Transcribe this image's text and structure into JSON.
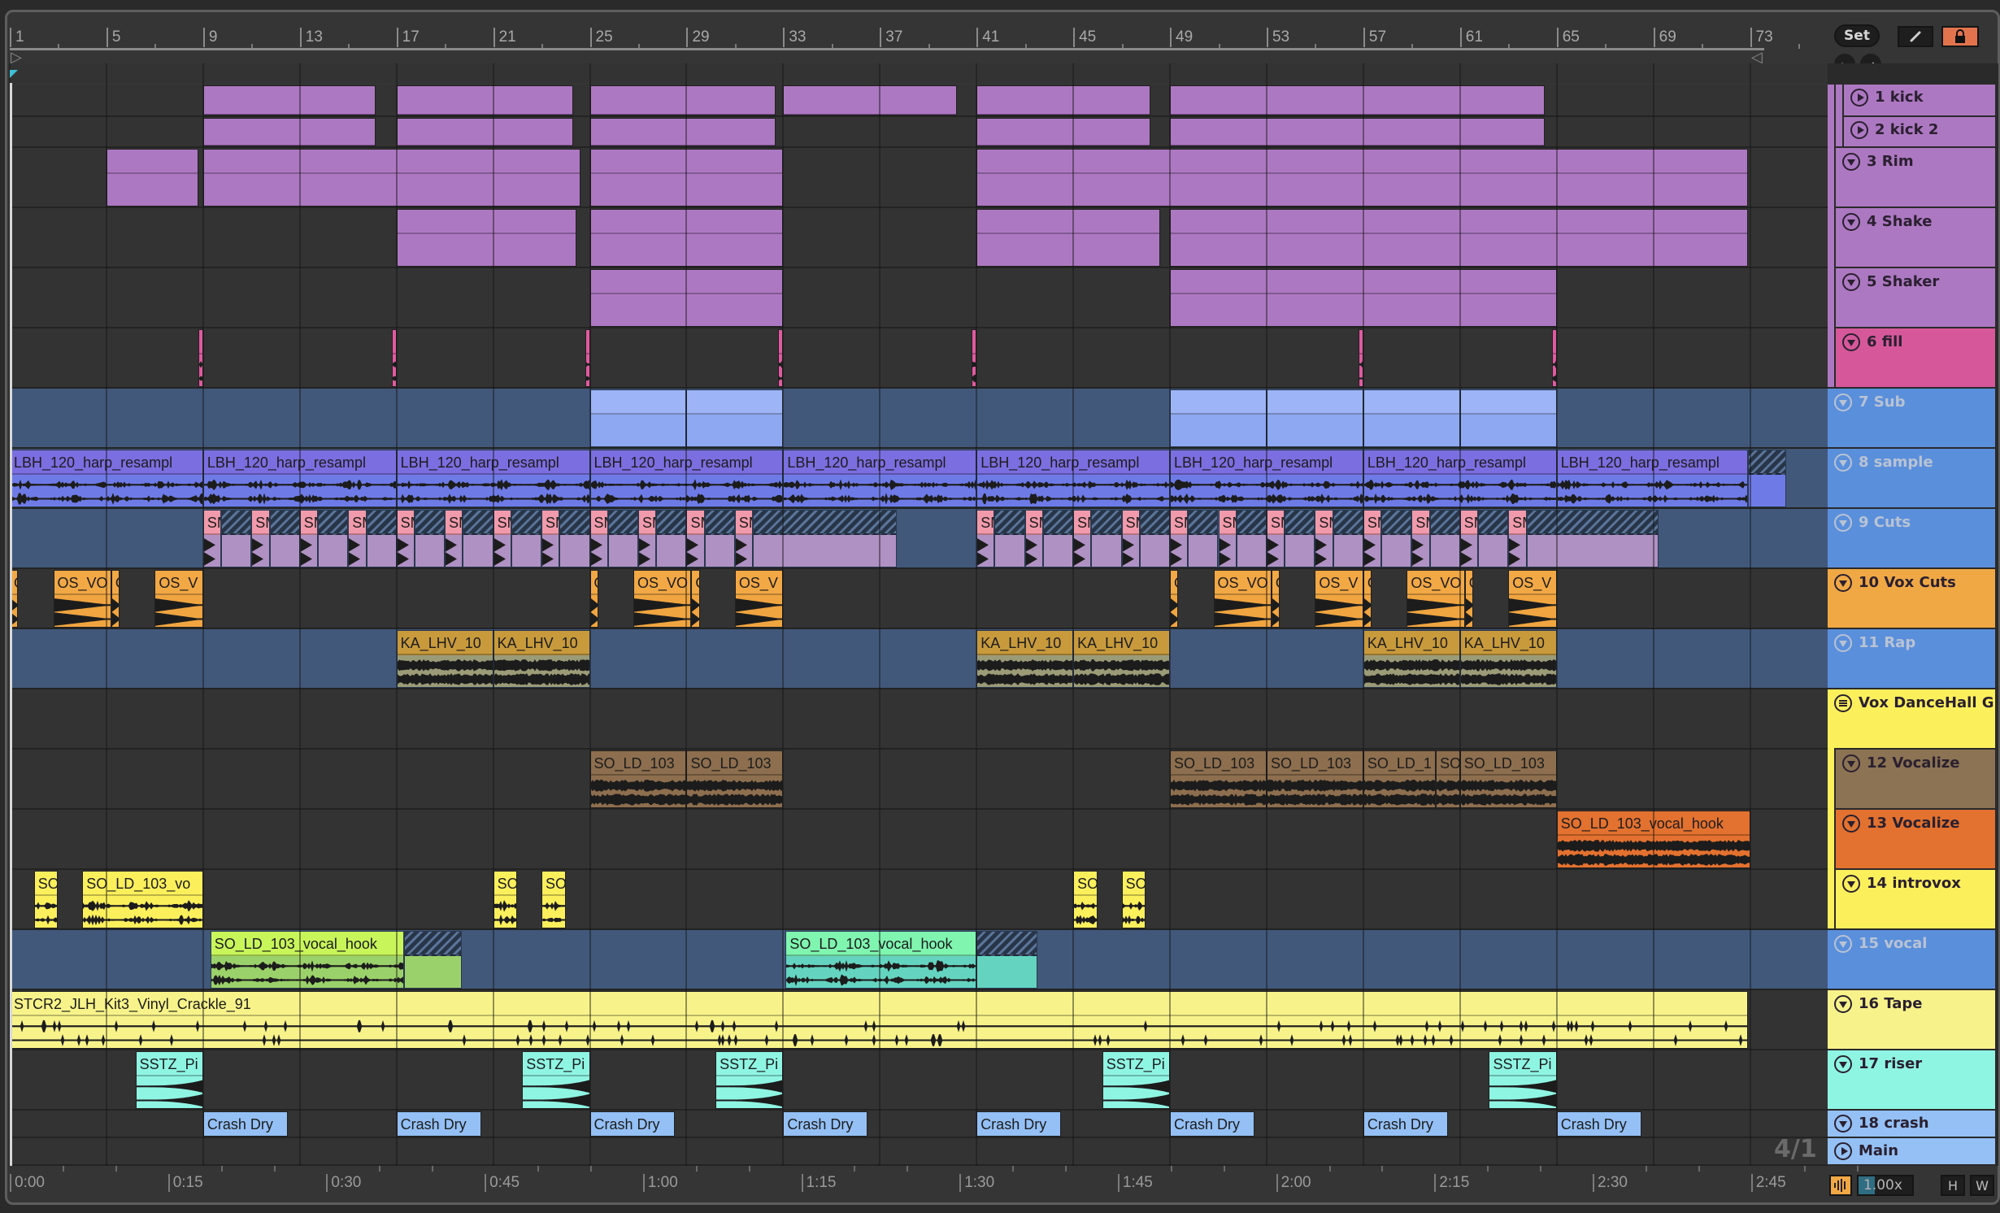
{
  "header_controls": {
    "set_label": "Set",
    "draw_mode_icon": "pencil-icon",
    "lock_icon": "lock-icon",
    "back_icon": "arrow-left-icon",
    "forward_icon": "arrow-right-icon"
  },
  "ruler": {
    "bar_labels": [
      "1",
      "5",
      "9",
      "13",
      "17",
      "21",
      "25",
      "29",
      "33",
      "37",
      "41",
      "45",
      "49",
      "53",
      "57",
      "61",
      "65",
      "69",
      "73"
    ],
    "loop_start_bar": 1,
    "loop_end_bar": 73
  },
  "time_ruler": {
    "labels": [
      "0:00",
      "0:15",
      "0:30",
      "0:45",
      "1:00",
      "1:15",
      "1:30",
      "1:45",
      "2:00",
      "2:15",
      "2:30",
      "2:45"
    ]
  },
  "grid_signature": "4/1",
  "footer": {
    "zoom_value": "1.00x",
    "h_label": "H",
    "w_label": "W",
    "waveform_icon": "waveform-icon"
  },
  "colors": {
    "accent_orange": "#e2734d",
    "lane_dark": "#333333",
    "lane_blue": "#41587a"
  },
  "tracks": [
    {
      "name": "1 kick",
      "color": "#ad78c2",
      "fold": "play",
      "lane": "dark",
      "kind": "blank",
      "clip": "#ad78c2",
      "body": "#ad78c2",
      "clips": [
        {
          "s": 9,
          "e": 16.15
        },
        {
          "s": 17,
          "e": 24.3
        },
        {
          "s": 25,
          "e": 32.7
        },
        {
          "s": 33,
          "e": 40.2
        },
        {
          "s": 41,
          "e": 48.2
        },
        {
          "s": 49,
          "e": 64.5
        }
      ]
    },
    {
      "name": "2 kick 2",
      "color": "#ad78c2",
      "fold": "play",
      "lane": "dark",
      "kind": "blank",
      "clip": "#ad78c2",
      "body": "#ad78c2",
      "clips": [
        {
          "s": 9,
          "e": 16.15
        },
        {
          "s": 17,
          "e": 24.3
        },
        {
          "s": 25,
          "e": 32.7
        },
        {
          "s": 41,
          "e": 48.2
        },
        {
          "s": 49,
          "e": 64.5
        }
      ]
    },
    {
      "name": "3 Rim",
      "color": "#ad78c2",
      "fold": "down",
      "lane": "dark",
      "kind": "midi",
      "clip": "#ad78c2",
      "body": "#ad78c2",
      "clips": [
        {
          "s": 5,
          "e": 8.8
        },
        {
          "s": 9,
          "e": 24.6
        },
        {
          "s": 25,
          "e": 33
        },
        {
          "s": 41,
          "e": 72.9
        }
      ]
    },
    {
      "name": "4 Shake",
      "color": "#ad78c2",
      "fold": "down",
      "lane": "dark",
      "kind": "midi",
      "clip": "#ad78c2",
      "body": "#ad78c2",
      "clips": [
        {
          "s": 17,
          "e": 24.45
        },
        {
          "s": 25,
          "e": 33
        },
        {
          "s": 41,
          "e": 48.6
        },
        {
          "s": 49,
          "e": 72.9
        }
      ]
    },
    {
      "name": "5 Shaker",
      "color": "#ad78c2",
      "fold": "down",
      "lane": "dark",
      "kind": "midi-dense",
      "clip": "#ad78c2",
      "body": "#ad78c2",
      "clips": [
        {
          "s": 25,
          "e": 33
        },
        {
          "s": 49,
          "e": 65
        }
      ]
    },
    {
      "name": "6 fill",
      "color": "#d6589a",
      "fold": "down",
      "lane": "dark",
      "kind": "audio",
      "clip": "#e05aa0",
      "body": "#e05aa0",
      "clips": [
        {
          "s": 8.8,
          "e": 9
        },
        {
          "s": 16.8,
          "e": 17
        },
        {
          "s": 24.8,
          "e": 25
        },
        {
          "s": 32.8,
          "e": 33
        },
        {
          "s": 40.8,
          "e": 41
        },
        {
          "s": 56.8,
          "e": 57
        },
        {
          "s": 64.8,
          "e": 65
        }
      ]
    },
    {
      "name": "7 Sub",
      "color": "#5a8fdc",
      "fold": "down",
      "muted": true,
      "lane": "blue",
      "kind": "notes",
      "clip": "#9db4f6",
      "body": "#8ea8f2",
      "clips": [
        {
          "s": 25,
          "e": 29
        },
        {
          "s": 29,
          "e": 33
        },
        {
          "s": 49,
          "e": 53
        },
        {
          "s": 53,
          "e": 57
        },
        {
          "s": 57,
          "e": 61
        },
        {
          "s": 61,
          "e": 65
        }
      ]
    },
    {
      "name": "8 sample",
      "color": "#5a8fdc",
      "fold": "down",
      "muted": true,
      "lane": "blue",
      "kind": "audio",
      "clip": "#7b6ee0",
      "body": "#6e7be6",
      "clips": [
        {
          "s": 1,
          "e": 9,
          "n": "LBH_120_harp_resampl"
        },
        {
          "s": 9,
          "e": 17,
          "n": "LBH_120_harp_resampl"
        },
        {
          "s": 17,
          "e": 25,
          "n": "LBH_120_harp_resampl"
        },
        {
          "s": 25,
          "e": 33,
          "n": "LBH_120_harp_resampl"
        },
        {
          "s": 33,
          "e": 41,
          "n": "LBH_120_harp_resampl"
        },
        {
          "s": 41,
          "e": 49,
          "n": "LBH_120_harp_resampl"
        },
        {
          "s": 49,
          "e": 57,
          "n": "LBH_120_harp_resampl"
        },
        {
          "s": 57,
          "e": 65,
          "n": "LBH_120_harp_resampl"
        },
        {
          "s": 65,
          "e": 72.9,
          "n": "LBH_120_harp_resampl"
        },
        {
          "s": 72.9,
          "e": 74.5,
          "k": "hatch"
        }
      ]
    },
    {
      "name": "9 Cuts",
      "color": "#5a8fdc",
      "fold": "down",
      "muted": true,
      "lane": "blue",
      "kind": "audio-short",
      "clip": "#f19aab",
      "body": "#b091c3",
      "clips": [
        {
          "s": 9,
          "e": 9.75,
          "n": "SM"
        },
        {
          "s": 9.75,
          "e": 11,
          "k": "hatch"
        },
        {
          "s": 11,
          "e": 11.75,
          "n": "SM"
        },
        {
          "s": 11.75,
          "e": 13,
          "k": "hatch"
        },
        {
          "s": 13,
          "e": 13.75,
          "n": "SM"
        },
        {
          "s": 13.75,
          "e": 15,
          "k": "hatch"
        },
        {
          "s": 15,
          "e": 15.75,
          "n": "SM"
        },
        {
          "s": 15.75,
          "e": 17,
          "k": "hatch"
        },
        {
          "s": 17,
          "e": 17.75,
          "n": "SM"
        },
        {
          "s": 17.75,
          "e": 19,
          "k": "hatch"
        },
        {
          "s": 19,
          "e": 19.75,
          "n": "SM"
        },
        {
          "s": 19.75,
          "e": 21,
          "k": "hatch"
        },
        {
          "s": 21,
          "e": 21.75,
          "n": "SM"
        },
        {
          "s": 21.75,
          "e": 23,
          "k": "hatch"
        },
        {
          "s": 23,
          "e": 23.75,
          "n": "SM"
        },
        {
          "s": 23.75,
          "e": 25,
          "k": "hatch"
        },
        {
          "s": 25,
          "e": 25.75,
          "n": "SM"
        },
        {
          "s": 25.75,
          "e": 27,
          "k": "hatch"
        },
        {
          "s": 27,
          "e": 27.75,
          "n": "SM"
        },
        {
          "s": 27.75,
          "e": 29,
          "k": "hatch"
        },
        {
          "s": 29,
          "e": 29.75,
          "n": "SM"
        },
        {
          "s": 29.75,
          "e": 31,
          "k": "hatch"
        },
        {
          "s": 31,
          "e": 31.75,
          "n": "SM"
        },
        {
          "s": 31.75,
          "e": 37.7,
          "k": "hatch"
        },
        {
          "s": 41,
          "e": 41.75,
          "n": "SM"
        },
        {
          "s": 41.75,
          "e": 43,
          "k": "hatch"
        },
        {
          "s": 43,
          "e": 43.75,
          "n": "SM"
        },
        {
          "s": 43.75,
          "e": 45,
          "k": "hatch"
        },
        {
          "s": 45,
          "e": 45.75,
          "n": "SM"
        },
        {
          "s": 45.75,
          "e": 47,
          "k": "hatch"
        },
        {
          "s": 47,
          "e": 47.75,
          "n": "SM"
        },
        {
          "s": 47.75,
          "e": 49,
          "k": "hatch"
        },
        {
          "s": 49,
          "e": 49.75,
          "n": "SM"
        },
        {
          "s": 49.75,
          "e": 51,
          "k": "hatch"
        },
        {
          "s": 51,
          "e": 51.75,
          "n": "SM"
        },
        {
          "s": 51.75,
          "e": 53,
          "k": "hatch"
        },
        {
          "s": 53,
          "e": 53.75,
          "n": "SM"
        },
        {
          "s": 53.75,
          "e": 55,
          "k": "hatch"
        },
        {
          "s": 55,
          "e": 55.75,
          "n": "SM"
        },
        {
          "s": 55.75,
          "e": 57,
          "k": "hatch"
        },
        {
          "s": 57,
          "e": 57.75,
          "n": "SM"
        },
        {
          "s": 57.75,
          "e": 59,
          "k": "hatch"
        },
        {
          "s": 59,
          "e": 59.75,
          "n": "SM"
        },
        {
          "s": 59.75,
          "e": 61,
          "k": "hatch"
        },
        {
          "s": 61,
          "e": 61.75,
          "n": "SM"
        },
        {
          "s": 61.75,
          "e": 63,
          "k": "hatch"
        },
        {
          "s": 63,
          "e": 63.75,
          "n": "SM"
        },
        {
          "s": 63.75,
          "e": 69.2,
          "k": "hatch"
        }
      ]
    },
    {
      "name": "10 Vox Cuts",
      "color": "#f0a845",
      "fold": "down",
      "lane": "dark",
      "kind": "audio-decay",
      "clip": "#f2a845",
      "body": "#f0a540",
      "clips": [
        {
          "s": 1,
          "e": 1.35,
          "n": "O"
        },
        {
          "s": 2.8,
          "e": 5.2,
          "n": "OS_VO"
        },
        {
          "s": 5.2,
          "e": 5.55,
          "n": "O"
        },
        {
          "s": 7,
          "e": 9,
          "n": "OS_V"
        },
        {
          "s": 25,
          "e": 25.35,
          "n": "O"
        },
        {
          "s": 26.8,
          "e": 29.2,
          "n": "OS_VO"
        },
        {
          "s": 29.2,
          "e": 29.55,
          "n": "O"
        },
        {
          "s": 31,
          "e": 33,
          "n": "OS_V"
        },
        {
          "s": 49,
          "e": 49.35,
          "n": "O"
        },
        {
          "s": 50.8,
          "e": 53.2,
          "n": "OS_VO"
        },
        {
          "s": 53.2,
          "e": 53.55,
          "n": "O"
        },
        {
          "s": 55,
          "e": 57,
          "n": "OS_V"
        },
        {
          "s": 57,
          "e": 57.35,
          "n": "O"
        },
        {
          "s": 58.8,
          "e": 61.2,
          "n": "OS_VO"
        },
        {
          "s": 61.2,
          "e": 61.55,
          "n": "O"
        },
        {
          "s": 63,
          "e": 65,
          "n": "OS_V"
        }
      ]
    },
    {
      "name": "11 Rap",
      "color": "#5a8fdc",
      "fold": "down",
      "muted": true,
      "lane": "blue",
      "kind": "audio-dense",
      "clip": "#c89a3c",
      "body": "#9b9b78",
      "clips": [
        {
          "s": 17,
          "e": 21,
          "n": "KA_LHV_10"
        },
        {
          "s": 21,
          "e": 25,
          "n": "KA_LHV_10"
        },
        {
          "s": 41,
          "e": 45,
          "n": "KA_LHV_10"
        },
        {
          "s": 45,
          "e": 49,
          "n": "KA_LHV_10"
        },
        {
          "s": 57,
          "e": 61,
          "n": "KA_LHV_10"
        },
        {
          "s": 61,
          "e": 65,
          "n": "KA_LHV_10"
        }
      ]
    },
    {
      "name": "Vox DanceHall G",
      "color": "#fbef5c",
      "fold": "group",
      "lane": "dark",
      "kind": "blank",
      "clip": "#333333",
      "body": "#333333",
      "clips": []
    },
    {
      "name": "12 Vocalize",
      "color": "#8b7353",
      "fold": "down",
      "lane": "dark",
      "kind": "audio-dense",
      "clip": "#8d6e4e",
      "body": "#8d6e4e",
      "clips": [
        {
          "s": 25,
          "e": 29,
          "n": "SO_LD_103"
        },
        {
          "s": 29,
          "e": 33,
          "n": "SO_LD_103"
        },
        {
          "s": 49,
          "e": 53,
          "n": "SO_LD_103"
        },
        {
          "s": 53,
          "e": 57,
          "n": "SO_LD_103"
        },
        {
          "s": 57,
          "e": 60,
          "n": "SO_LD_1"
        },
        {
          "s": 60,
          "e": 61,
          "n": "SO"
        },
        {
          "s": 61,
          "e": 65,
          "n": "SO_LD_103"
        }
      ]
    },
    {
      "name": "13 Vocalize",
      "color": "#e3712f",
      "fold": "down",
      "lane": "dark",
      "kind": "audio-dense",
      "clip": "#e3712f",
      "body": "#e3712f",
      "clips": [
        {
          "s": 65,
          "e": 73,
          "n": "SO_LD_103_vocal_hook"
        }
      ]
    },
    {
      "name": "14 introvox",
      "color": "#fbef5c",
      "fold": "down",
      "lane": "dark",
      "kind": "audio",
      "clip": "#fbef5c",
      "body": "#fbef5c",
      "clips": [
        {
          "s": 2,
          "e": 3,
          "n": "SO"
        },
        {
          "s": 4,
          "e": 9,
          "n": "SO_LD_103_vo"
        },
        {
          "s": 21,
          "e": 22,
          "n": "SO"
        },
        {
          "s": 23,
          "e": 24,
          "n": "SO"
        },
        {
          "s": 45,
          "e": 46,
          "n": "SO"
        },
        {
          "s": 47,
          "e": 48,
          "n": "SO"
        }
      ]
    },
    {
      "name": "15 vocal",
      "color": "#5a8fdc",
      "fold": "down",
      "muted": true,
      "lane": "blue",
      "kind": "audio",
      "clip": "#c8f55a",
      "body": "#9bd16a",
      "clips": [
        {
          "s": 9.3,
          "e": 17.3,
          "n": "SO_LD_103_vocal_hook"
        },
        {
          "s": 17.3,
          "e": 19.7,
          "k": "hatch"
        },
        {
          "s": 33.1,
          "e": 41,
          "n": "SO_LD_103_vocal_hook",
          "c": "#7ff5b0",
          "b": "#64d4c0"
        },
        {
          "s": 41,
          "e": 43.5,
          "k": "hatch",
          "b": "#64d4c0"
        }
      ]
    },
    {
      "name": "16 Tape",
      "color": "#f7f38a",
      "fold": "down",
      "lane": "dark",
      "kind": "audio-sparse",
      "clip": "#f7f38a",
      "body": "#f7f38a",
      "clips": [
        {
          "s": 1,
          "e": 72.9,
          "n": "STCR2_JLH_Kit3_Vinyl_Crackle_91"
        }
      ]
    },
    {
      "name": "17 riser",
      "color": "#8ff5e3",
      "fold": "down",
      "lane": "dark",
      "kind": "audio-rise",
      "clip": "#8ff5e3",
      "body": "#8ff5e3",
      "clips": [
        {
          "s": 6.2,
          "e": 9,
          "n": "SSTZ_Pi"
        },
        {
          "s": 22.2,
          "e": 25,
          "n": "SSTZ_Pi"
        },
        {
          "s": 30.2,
          "e": 33,
          "n": "SSTZ_Pi"
        },
        {
          "s": 46.2,
          "e": 49,
          "n": "SSTZ_Pi"
        },
        {
          "s": 62.2,
          "e": 65,
          "n": "SSTZ_Pi"
        }
      ]
    },
    {
      "name": "18 crash",
      "color": "#94c0f5",
      "fold": "down",
      "lane": "dark",
      "kind": "blank",
      "clip": "#94c0f5",
      "body": "#94c0f5",
      "clips": [
        {
          "s": 9,
          "e": 12.5,
          "n": "Crash Dry"
        },
        {
          "s": 17,
          "e": 20.5,
          "n": "Crash Dry"
        },
        {
          "s": 25,
          "e": 28.5,
          "n": "Crash Dry"
        },
        {
          "s": 33,
          "e": 36.5,
          "n": "Crash Dry"
        },
        {
          "s": 41,
          "e": 44.5,
          "n": "Crash Dry"
        },
        {
          "s": 49,
          "e": 52.5,
          "n": "Crash Dry"
        },
        {
          "s": 57,
          "e": 60.5,
          "n": "Crash Dry"
        },
        {
          "s": 65,
          "e": 68.5,
          "n": "Crash Dry"
        }
      ]
    },
    {
      "name": "Main",
      "color": "#94c0f5",
      "fold": "play",
      "lane": "dark",
      "kind": "blank",
      "clip": "#333333",
      "body": "#333333",
      "clips": []
    }
  ]
}
